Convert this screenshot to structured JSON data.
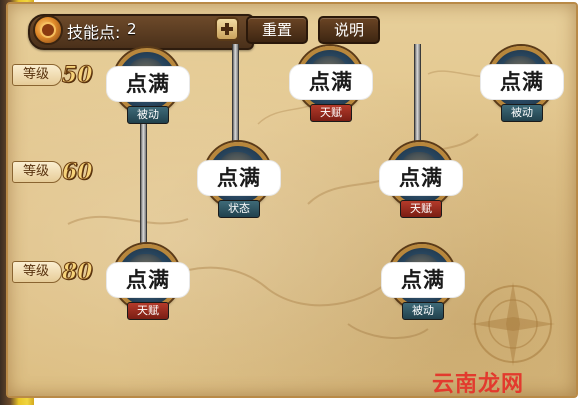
{
  "topbar": {
    "skill_points_label": "技能点:",
    "skill_points_value": "2",
    "reset_label": "重置",
    "help_label": "说明"
  },
  "levels": [
    {
      "label": "等级",
      "value": "50"
    },
    {
      "label": "等级",
      "value": "60"
    },
    {
      "label": "等级",
      "value": "80"
    }
  ],
  "nodes": [
    {
      "bubble": "点满",
      "type": "被动",
      "type_color": "#2f5866"
    },
    {
      "bubble": "点满",
      "type": "天赋",
      "type_color": "#9a2c20"
    },
    {
      "bubble": "点满",
      "type": "被动",
      "type_color": "#2f5866"
    },
    {
      "bubble": "点满",
      "type": "状态",
      "type_color": "#2f5866"
    },
    {
      "bubble": "点满",
      "type": "天赋",
      "type_color": "#9a2c20"
    },
    {
      "bubble": "点满",
      "type": "天赋",
      "type_color": "#9a2c20"
    },
    {
      "bubble": "点满",
      "type": "被动",
      "type_color": "#2f5866"
    }
  ],
  "icons": {
    "skill_point_icon": "coin-icon",
    "add_button_icon": "plus-icon"
  },
  "watermark": "云南龙网"
}
